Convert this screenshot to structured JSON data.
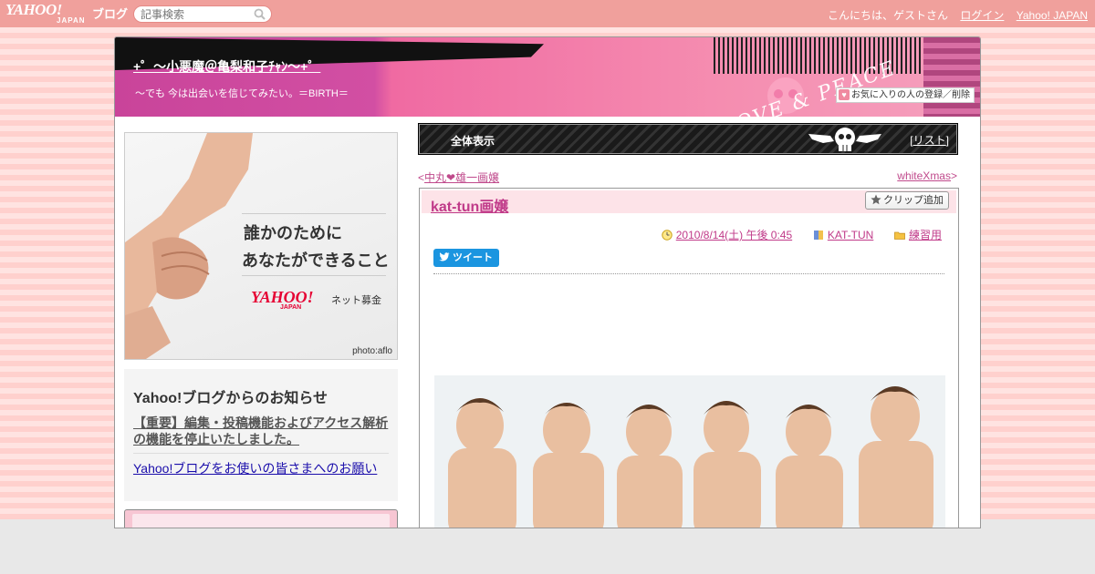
{
  "topbar": {
    "logo": "YAHOO!",
    "logo_sub": "JAPAN",
    "blog_word": "ブログ",
    "search_placeholder": "記事検索",
    "greeting": "こんにちは、ゲストさん",
    "login": "ログイン",
    "yahoo_japan": "Yahoo! JAPAN"
  },
  "header": {
    "title": "+゜～小悪魔＠亀梨和子ﾁｬﾝ～+゜",
    "subtitle": "～でも 今は出会いを信じてみたい。＝BIRTH＝",
    "fav_button": "お気に入りの人の登録／削除",
    "deco_text": "LOVE & PEACE"
  },
  "ad": {
    "line1": "誰かのために",
    "line2": "あなたができること",
    "logo": "YAHOO!",
    "logo_jp": "JAPAN",
    "logo_sub": "ネット募金",
    "photo_credit": "photo:aflo"
  },
  "notice": {
    "title": "Yahoo!ブログからのお知らせ",
    "link1": "【重要】編集・投稿機能およびアクセス解析の機能を停止いたしました。",
    "link2": "Yahoo!ブログをお使いの皆さまへのお願い"
  },
  "view_bar": {
    "label": "全体表示",
    "list_open": "[",
    "list_label": "リスト",
    "list_close": "]"
  },
  "nav": {
    "prev_arrow": "<",
    "prev_label": "中丸❤雄一画嬢",
    "next_label": "whiteXmas",
    "next_arrow": ">"
  },
  "article": {
    "title": "kat-tun画嬢",
    "clip_button": "クリップ追加",
    "date": "2010/8/14(土) 午後 0:45",
    "tag": "KAT-TUN",
    "category": "練習用",
    "tweet": "ツイート"
  }
}
